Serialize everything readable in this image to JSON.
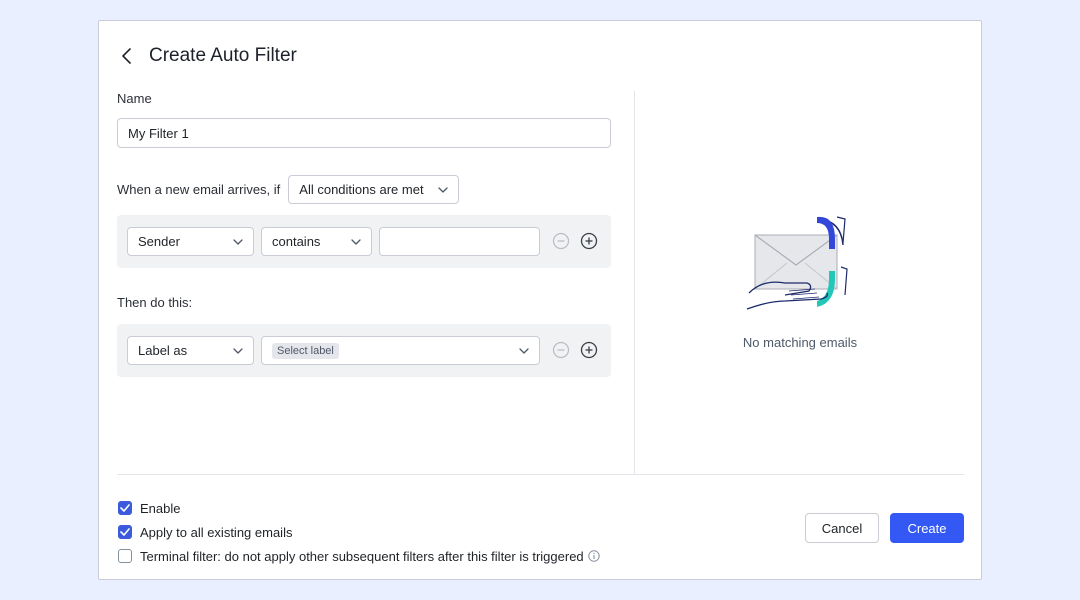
{
  "dialog": {
    "title": "Create Auto Filter",
    "back_icon": "chevron-left-icon"
  },
  "name_field": {
    "label": "Name",
    "value": "My Filter 1"
  },
  "conditions": {
    "prefix": "When a new email arrives, if",
    "match_mode": "All conditions are met",
    "rules": [
      {
        "field": "Sender",
        "operator": "contains",
        "value": ""
      }
    ]
  },
  "actions": {
    "label": "Then do this:",
    "rules": [
      {
        "action": "Label as",
        "target_placeholder": "Select label"
      }
    ]
  },
  "preview": {
    "empty_text": "No matching emails",
    "illustration_icon": "envelope-in-hand-icon"
  },
  "options": [
    {
      "label": "Enable",
      "checked": true
    },
    {
      "label": "Apply to all existing emails",
      "checked": true
    },
    {
      "label": "Terminal filter: do not apply other subsequent filters after this filter is triggered",
      "checked": false,
      "info_icon": "info-icon"
    }
  ],
  "footer": {
    "cancel_label": "Cancel",
    "create_label": "Create"
  },
  "colors": {
    "background": "#e9efff",
    "primary": "#3358f4",
    "checkbox": "#3b5bdb",
    "accent_teal": "#22c7b8",
    "rule_bg": "#f1f2f4"
  }
}
